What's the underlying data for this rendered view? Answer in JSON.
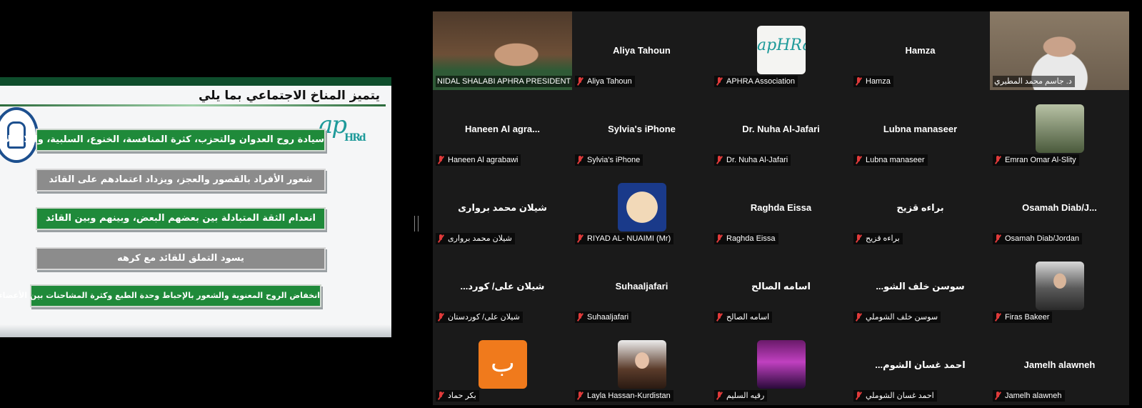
{
  "slide": {
    "title": "يتميز المناخ الاجتماعي بما يلي",
    "logo_text": "ap",
    "logo_text_small": "HRd",
    "bullets": [
      "سيادة روح العدوان والتحزب، كثرة المنافسة، الخنوع، السلبية، واللامبالاة",
      "شعور الأفراد بالقصور والعجز، ويزداد اعتمادهم على القائد",
      "انعدام الثقة المتبادلة بين بعضهم البعض، وبينهم وبين القائد",
      "يسود التملق للقائد مع كرهه",
      "انخفاض الروح المعنوية والشعور بالإحباط وحدة الطبع وكثرة المشاحنات بين الأعضاء"
    ]
  },
  "participants": [
    {
      "label": "NIDAL SHALABI APHRA PRESIDENT",
      "tile_name": "",
      "media": "video-nidal",
      "muted": false,
      "active": false
    },
    {
      "label": "Aliya Tahoun",
      "tile_name": "Aliya Tahoun",
      "media": "",
      "muted": true,
      "active": false
    },
    {
      "label": "APHRA Association",
      "tile_name": "",
      "media": "av-aphra",
      "media_text": "apHRa",
      "muted": true,
      "active": false
    },
    {
      "label": "Hamza",
      "tile_name": "Hamza",
      "media": "",
      "muted": true,
      "active": false
    },
    {
      "label": "د. جاسم محمد المطيري",
      "tile_name": "",
      "media": "video-jasim",
      "muted": false,
      "active": true
    },
    {
      "label": "Haneen Al agrabawi",
      "tile_name": "Haneen Al agra...",
      "media": "",
      "muted": true,
      "active": false
    },
    {
      "label": "Sylvia's iPhone",
      "tile_name": "Sylvia's iPhone",
      "media": "",
      "muted": true,
      "active": false
    },
    {
      "label": "Dr. Nuha Al-Jafari",
      "tile_name": "Dr. Nuha Al-Jafari",
      "media": "",
      "muted": true,
      "active": false
    },
    {
      "label": "Lubna manaseer",
      "tile_name": "Lubna manaseer",
      "media": "",
      "muted": true,
      "active": false
    },
    {
      "label": "Emran Omar Al-Slity",
      "tile_name": "",
      "media": "av-emran",
      "muted": true,
      "active": false
    },
    {
      "label": "شيلان محمد بروارى",
      "tile_name": "شيلان محمد بروارى",
      "media": "",
      "muted": true,
      "active": false
    },
    {
      "label": "RIYAD AL- NUAIMI (Mr)",
      "tile_name": "",
      "media": "av-riyad",
      "muted": true,
      "active": false
    },
    {
      "label": "Raghda Eissa",
      "tile_name": "Raghda Eissa",
      "media": "",
      "muted": true,
      "active": false
    },
    {
      "label": "براءه قزيح",
      "tile_name": "براءه قزيح",
      "media": "",
      "muted": true,
      "active": false
    },
    {
      "label": "Osamah Diab/Jordan",
      "tile_name": "Osamah  Diab/J...",
      "media": "",
      "muted": true,
      "active": false
    },
    {
      "label": "شيلان على/ كوردستان",
      "tile_name": "...شيلان على/ كورد",
      "media": "",
      "muted": true,
      "active": false
    },
    {
      "label": "Suhaaljafari",
      "tile_name": "Suhaaljafari",
      "media": "",
      "muted": true,
      "active": false
    },
    {
      "label": "اسامه الصالح",
      "tile_name": "اسامه الصالح",
      "media": "",
      "muted": true,
      "active": false
    },
    {
      "label": "سوسن خلف الشوملي",
      "tile_name": "...سوسن خلف الشو",
      "media": "",
      "muted": true,
      "active": false
    },
    {
      "label": "Firas Bakeer",
      "tile_name": "",
      "media": "av-firas",
      "muted": true,
      "active": false
    },
    {
      "label": "بكر حماد",
      "tile_name": "",
      "media": "av-bakr",
      "media_text": "ب",
      "muted": true,
      "active": false
    },
    {
      "label": "Layla Hassan-Kurdistan",
      "tile_name": "",
      "media": "av-layla",
      "muted": true,
      "active": false
    },
    {
      "label": "رقيه السليم",
      "tile_name": "",
      "media": "av-ruqaya",
      "muted": true,
      "active": false
    },
    {
      "label": "احمد غسان الشوملي",
      "tile_name": "...احمد غسان الشوم",
      "media": "",
      "muted": true,
      "active": false
    },
    {
      "label": "Jamelh alawneh",
      "tile_name": "Jamelh alawneh",
      "media": "",
      "muted": true,
      "active": false
    }
  ]
}
